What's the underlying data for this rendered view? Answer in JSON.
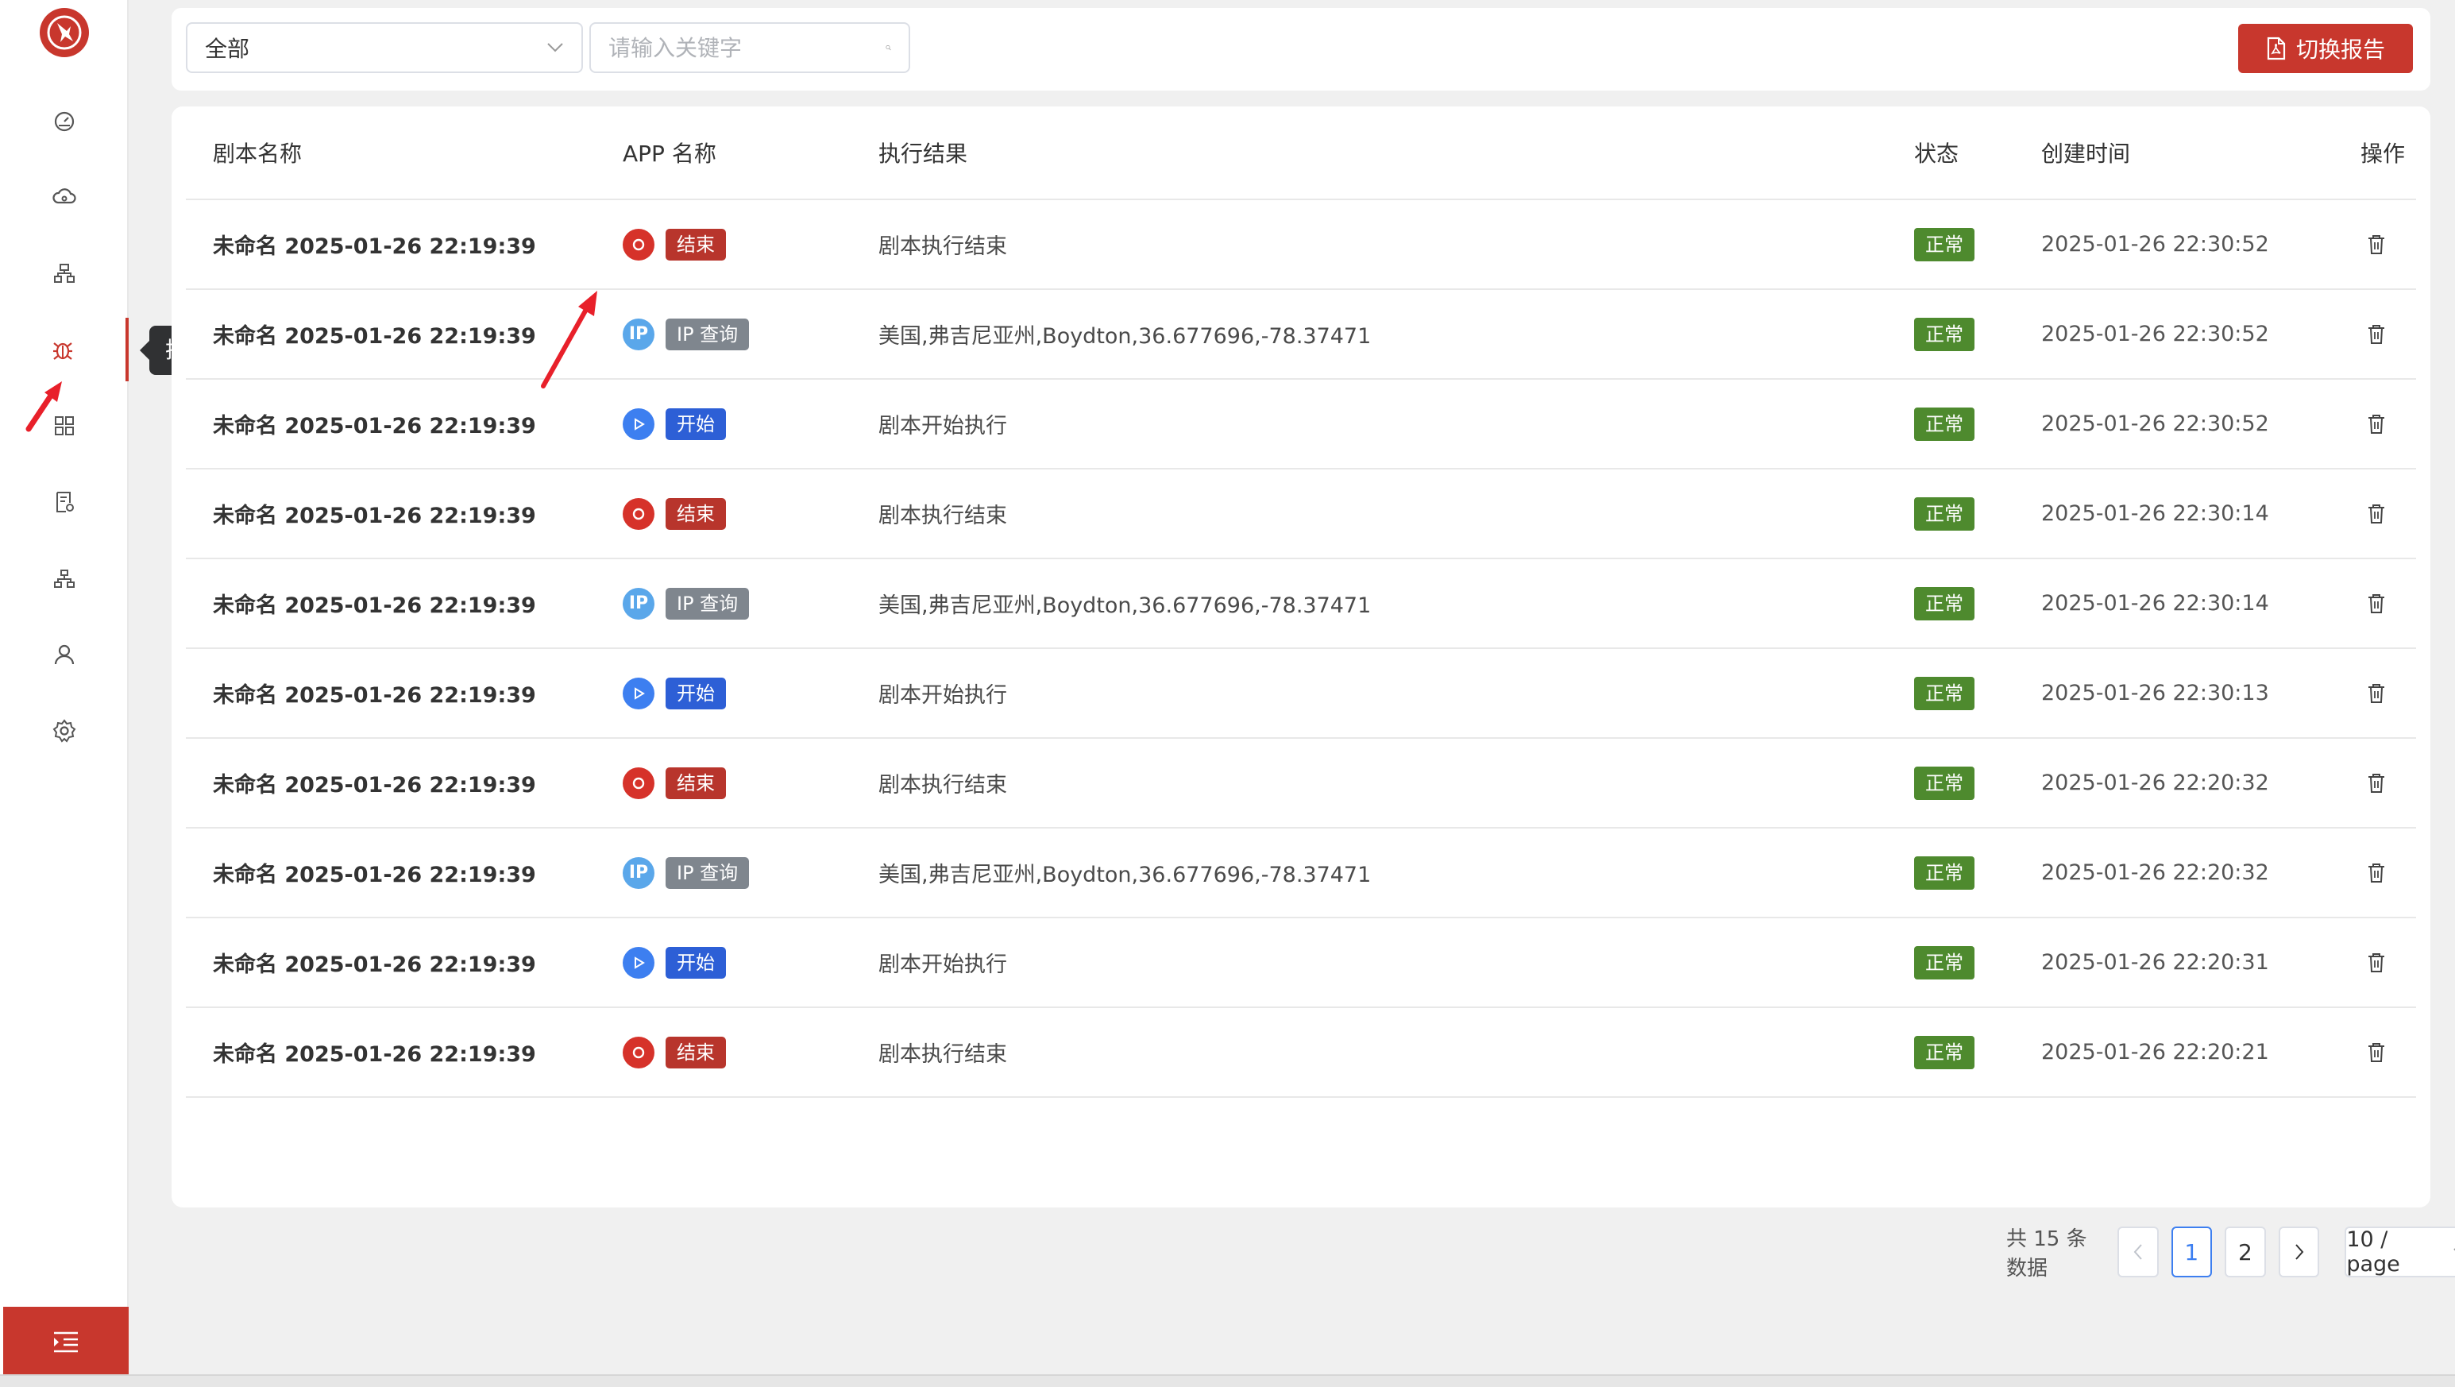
{
  "sidebar": {
    "items": [
      {
        "icon": "dashboard-icon"
      },
      {
        "icon": "cloud-icon"
      },
      {
        "icon": "sitemap-icon"
      },
      {
        "icon": "bug-icon",
        "active": true
      },
      {
        "icon": "grid-icon"
      },
      {
        "icon": "report-icon"
      },
      {
        "icon": "network-icon"
      },
      {
        "icon": "user-icon"
      },
      {
        "icon": "settings-icon"
      }
    ],
    "tooltip": "执行日志",
    "toggle_icon": "menu-indent-icon"
  },
  "toolbar": {
    "select_value": "全部",
    "search_placeholder": "请输入关键字",
    "switch_button": "切换报告"
  },
  "table": {
    "headers": {
      "name": "剧本名称",
      "app": "APP 名称",
      "result": "执行结果",
      "status": "状态",
      "time": "创建时间",
      "op": "操作"
    },
    "rows": [
      {
        "name": "未命名 2025-01-26 22:19:39",
        "app_type": "end",
        "app_label": "结束",
        "result": "剧本执行结束",
        "status": "正常",
        "created": "2025-01-26 22:30:52"
      },
      {
        "name": "未命名 2025-01-26 22:19:39",
        "app_type": "ip",
        "app_label": "IP 查询",
        "result": "美国,弗吉尼亚州,Boydton,36.677696,-78.37471",
        "status": "正常",
        "created": "2025-01-26 22:30:52"
      },
      {
        "name": "未命名 2025-01-26 22:19:39",
        "app_type": "start",
        "app_label": "开始",
        "result": "剧本开始执行",
        "status": "正常",
        "created": "2025-01-26 22:30:52"
      },
      {
        "name": "未命名 2025-01-26 22:19:39",
        "app_type": "end",
        "app_label": "结束",
        "result": "剧本执行结束",
        "status": "正常",
        "created": "2025-01-26 22:30:14"
      },
      {
        "name": "未命名 2025-01-26 22:19:39",
        "app_type": "ip",
        "app_label": "IP 查询",
        "result": "美国,弗吉尼亚州,Boydton,36.677696,-78.37471",
        "status": "正常",
        "created": "2025-01-26 22:30:14"
      },
      {
        "name": "未命名 2025-01-26 22:19:39",
        "app_type": "start",
        "app_label": "开始",
        "result": "剧本开始执行",
        "status": "正常",
        "created": "2025-01-26 22:30:13"
      },
      {
        "name": "未命名 2025-01-26 22:19:39",
        "app_type": "end",
        "app_label": "结束",
        "result": "剧本执行结束",
        "status": "正常",
        "created": "2025-01-26 22:20:32"
      },
      {
        "name": "未命名 2025-01-26 22:19:39",
        "app_type": "ip",
        "app_label": "IP 查询",
        "result": "美国,弗吉尼亚州,Boydton,36.677696,-78.37471",
        "status": "正常",
        "created": "2025-01-26 22:20:32"
      },
      {
        "name": "未命名 2025-01-26 22:19:39",
        "app_type": "start",
        "app_label": "开始",
        "result": "剧本开始执行",
        "status": "正常",
        "created": "2025-01-26 22:20:31"
      },
      {
        "name": "未命名 2025-01-26 22:19:39",
        "app_type": "end",
        "app_label": "结束",
        "result": "剧本执行结束",
        "status": "正常",
        "created": "2025-01-26 22:20:21"
      }
    ],
    "row_action_icon": "delete-icon"
  },
  "pagination": {
    "total_text": "共 15 条数据",
    "pages": [
      "1",
      "2"
    ],
    "current": "1",
    "page_size": "10 / page"
  },
  "colors": {
    "brand": "#c8372d",
    "status_ok": "#4e8a2e",
    "start_tag": "#2d5fd6",
    "ip_tag": "#7f868e",
    "annotation_arrow": "#e8202a"
  }
}
